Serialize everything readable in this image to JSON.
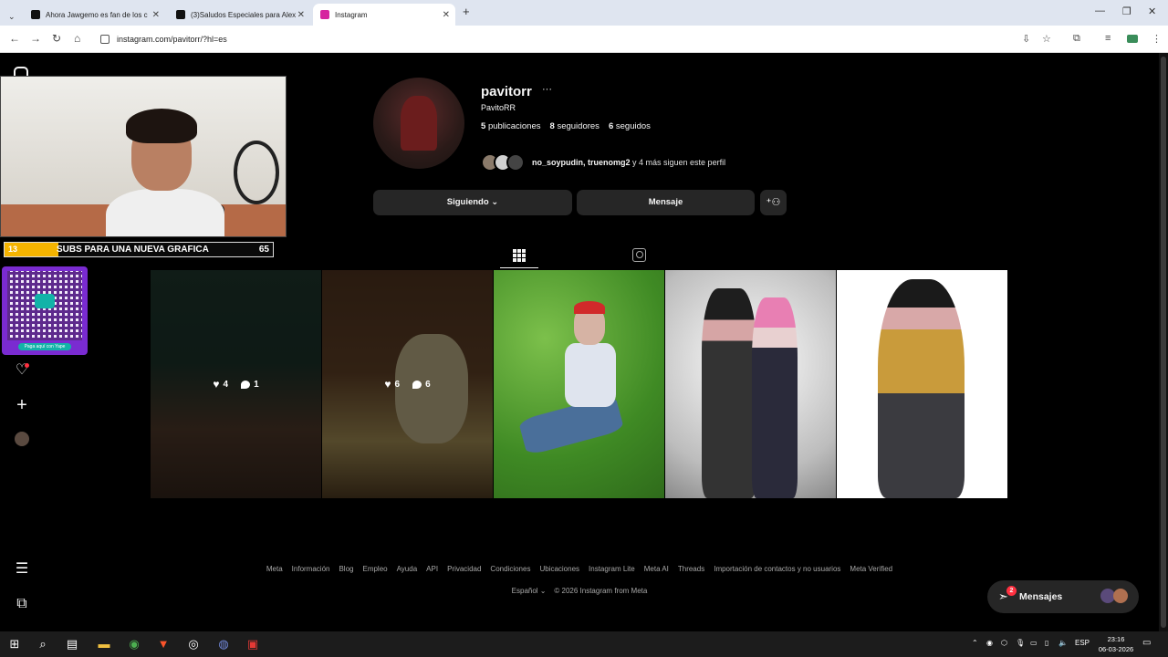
{
  "browser": {
    "tabs": [
      {
        "label": "Ahora Jawgemo es fan de los c",
        "fav": "#111"
      },
      {
        "label": "(3)Saludos Especiales para Alex",
        "fav": "#111"
      },
      {
        "label": "Instagram",
        "fav": "#d6249f"
      }
    ],
    "url": "instagram.com/pavitorr/?hl=es"
  },
  "overlay": {
    "sub_count_left": "13",
    "sub_text": "SUBS PARA UNA NUEVA GRAFICA",
    "sub_count_right": "65",
    "sub_progress": 0.2,
    "qr_caption": "Paga aquí con Yape"
  },
  "profile": {
    "username": "pavitorr",
    "more": "···",
    "full_name": "PavitoRR",
    "posts_count": "5",
    "posts_label": "publicaciones",
    "followers_count": "8",
    "followers_label": "seguidores",
    "following_count": "6",
    "following_label": "seguidos",
    "followed_by_names": "no_soypudin, truenomg2",
    "followed_by_rest": " y 4 más siguen este perfil",
    "following_btn": "Siguiendo ⌄",
    "message_btn": "Mensaje"
  },
  "posts": [
    {
      "likes": "4",
      "comments": "1"
    },
    {
      "likes": "6",
      "comments": "6"
    }
  ],
  "footer": {
    "links": [
      "Meta",
      "Información",
      "Blog",
      "Empleo",
      "Ayuda",
      "API",
      "Privacidad",
      "Condiciones",
      "Ubicaciones",
      "Instagram Lite",
      "Meta AI",
      "Threads",
      "Importación de contactos y no usuarios",
      "Meta Verified"
    ],
    "language": "Español ⌄",
    "copyright": "© 2026 Instagram from Meta"
  },
  "messages": {
    "label": "Mensajes",
    "badge": "2"
  },
  "taskbar": {
    "lang": "ESP",
    "time": "23:16",
    "date": "06-03-2026"
  }
}
